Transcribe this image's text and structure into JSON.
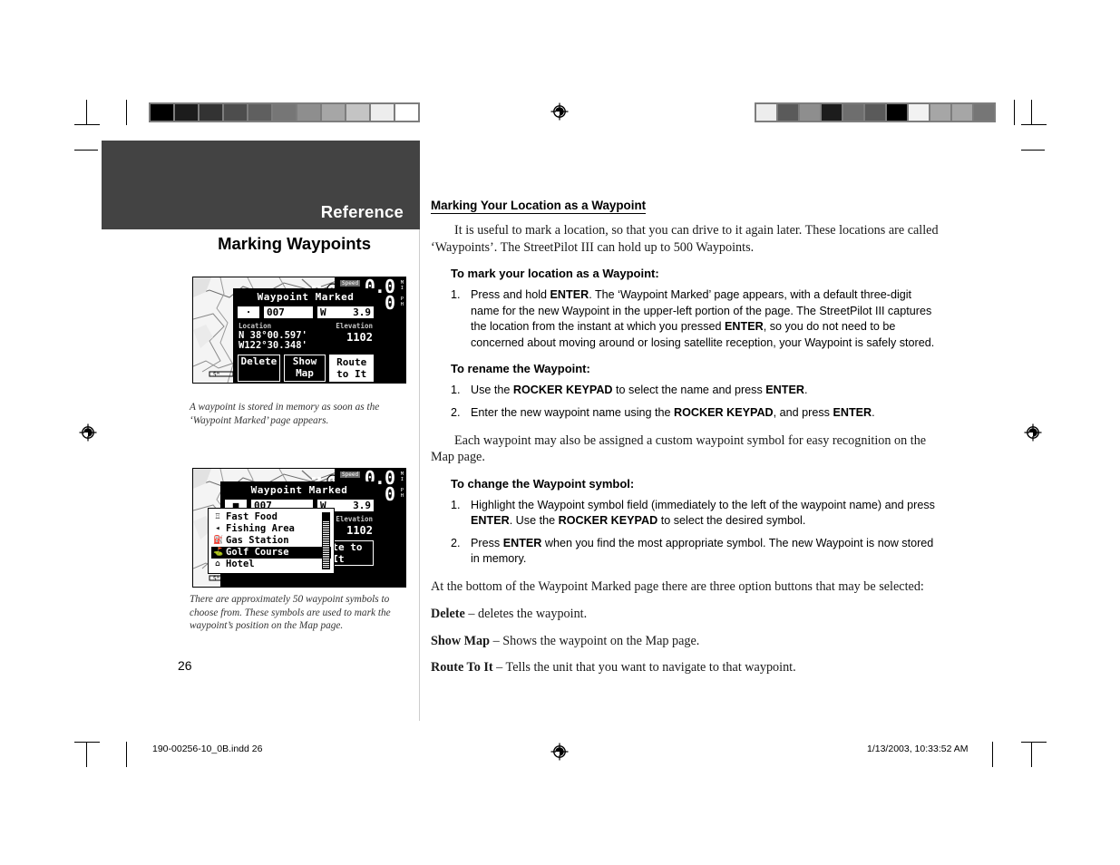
{
  "print_marks": {
    "wedge_left": [
      "#000000",
      "#1c1c1c",
      "#333333",
      "#4d4d4d",
      "#5f5f5f",
      "#767676",
      "#8e8e8e",
      "#a6a6a6",
      "#c4c4c4",
      "#ededed",
      "#ffffff"
    ],
    "wedge_right": [
      "#ededed",
      "#5a5a5a",
      "#8e8e8e",
      "#1c1c1c",
      "#6e6e6e",
      "#5a5a5a",
      "#000000",
      "#f2f2f2",
      "#a6a6a6",
      "#a6a6a6",
      "#767676"
    ],
    "registration_icon": "registration-target-icon"
  },
  "left_column": {
    "band_label": "Reference",
    "band_color": "#434343",
    "chapter_title": "Marking Waypoints",
    "caption_1": "A waypoint is stored in memory as soon as the ‘Waypoint Marked’ page appears.",
    "caption_2": "There are approximately 50 waypoint symbols to choose from.  These symbols are used to mark the waypoint’s position on the Map page.",
    "page_number": "26"
  },
  "gps_screen_1": {
    "dialog_title": "Waypoint Marked",
    "symbol_field": "·",
    "name_field": "007",
    "direction_label": "W",
    "direction_value": "3.9",
    "direction_unit": "ᴇ",
    "location_label": "Location",
    "elevation_label": "Elevation",
    "lat": "N 38°00.597'",
    "lon": "W122°30.348'",
    "elevation_value": "1102",
    "elevation_unit": "ᴇ",
    "buttons": [
      "Delete",
      "Show Map",
      "Route to It"
    ],
    "selected_button": "Route to It",
    "speed_label": "Speed",
    "speed_value": "0.0",
    "speed_value_2": "0",
    "speed_unit_top": "M\nI",
    "speed_unit_bottom": "P\nH",
    "map_scale": "5ᴹ"
  },
  "gps_screen_2": {
    "dialog_title": "Waypoint Marked",
    "symbol_field": "■",
    "name_field": "007",
    "direction_label": "W",
    "direction_value": "3.9",
    "direction_unit": "ᴇ",
    "elevation_label": "Elevation",
    "elevation_value": "1102",
    "elevation_unit": "ᴇ",
    "symbol_list": [
      {
        "glyph": "♖",
        "label": "Fast Food"
      },
      {
        "glyph": "◂",
        "label": "Fishing Area"
      },
      {
        "glyph": "⛽",
        "label": "Gas Station"
      },
      {
        "glyph": "⛳",
        "label": "Golf Course"
      },
      {
        "glyph": "⌂",
        "label": "Hotel"
      }
    ],
    "selected_symbol": "Golf Course",
    "button_route": "Route to It",
    "speed_label": "Speed",
    "speed_value": "0.0",
    "speed_value_2": "0",
    "map_scale": "5ᴹ"
  },
  "right_column": {
    "section_heading": "Marking Your Location as a Waypoint",
    "intro_paragraph": "It is useful to mark a location, so that you can drive to it again later.  These locations are called ‘Waypoints’.  The StreetPilot III can hold up to 500 Waypoints.",
    "mark_heading": "To mark your location as a Waypoint:",
    "mark_steps": [
      {
        "number": "1.",
        "text": "Press and hold ENTER.  The ‘Waypoint Marked’ page appears, with a default three-digit name for the new Waypoint in the upper-left portion of the page. The StreetPilot III captures the location from the instant at which you pressed ENTER, so you do not need to be concerned about moving around or losing satellite reception, your Waypoint is safely stored."
      }
    ],
    "rename_heading": "To rename the Waypoint:",
    "rename_steps": [
      {
        "number": "1.",
        "text": "Use the ROCKER KEYPAD to select the name and press ENTER."
      },
      {
        "number": "2.",
        "text": "Enter the new waypoint name using the ROCKER KEYPAD, and press ENTER."
      }
    ],
    "custom_symbol_paragraph": "Each waypoint may also be assigned a custom waypoint symbol for easy recognition on the Map page.",
    "change_heading": "To change the Waypoint symbol:",
    "change_steps": [
      {
        "number": "1.",
        "text": "Highlight the Waypoint symbol field (immediately to the left of the waypoint name) and press ENTER. Use the ROCKER KEYPAD to select the desired symbol."
      },
      {
        "number": "2.",
        "text": "Press ENTER when you find the most appropriate symbol.  The new Waypoint is now stored in memory."
      }
    ],
    "options_paragraph": "At the bottom of the Waypoint Marked page there are three option buttons that may be selected:",
    "definitions": [
      {
        "term": "Delete",
        "desc": " – deletes the waypoint."
      },
      {
        "term": "Show Map",
        "desc": " – Shows the waypoint on the Map page."
      },
      {
        "term": "Route To It",
        "desc": " – Tells the unit that you want to navigate to that waypoint."
      }
    ]
  },
  "footer": {
    "left": "190-00256-10_0B.indd   26",
    "right": "1/13/2003, 10:33:52 AM"
  }
}
